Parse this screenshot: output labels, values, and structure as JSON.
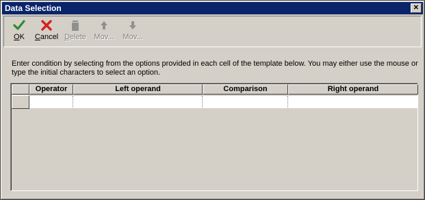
{
  "window": {
    "title": "Data Selection",
    "close_glyph": "✕"
  },
  "toolbar": {
    "buttons": [
      {
        "label_accel": "O",
        "label_rest": "K",
        "icon": "checkmark-icon",
        "enabled": true
      },
      {
        "label_accel": "C",
        "label_rest": "ancel",
        "icon": "x-cancel-icon",
        "enabled": true
      },
      {
        "label_accel": "D",
        "label_rest": "elete",
        "icon": "trash-icon",
        "enabled": false
      },
      {
        "label": "Mov...",
        "icon": "arrow-up-icon",
        "enabled": false
      },
      {
        "label": "Mov...",
        "icon": "arrow-down-icon",
        "enabled": false
      }
    ]
  },
  "instructions": "Enter condition by selecting from the options provided in each cell of the template below. You may either use the mouse or type the initial characters to select an option.",
  "grid": {
    "columns": [
      "Operator",
      "Left operand",
      "Comparison",
      "Right operand"
    ],
    "rows": [
      [
        "",
        "",
        "",
        ""
      ]
    ]
  },
  "colors": {
    "title_bar": "#0a246a",
    "face": "#d4d0c8",
    "ok_green": "#2e8b2e",
    "cancel_red": "#d42020",
    "disabled_gray": "#808080"
  }
}
